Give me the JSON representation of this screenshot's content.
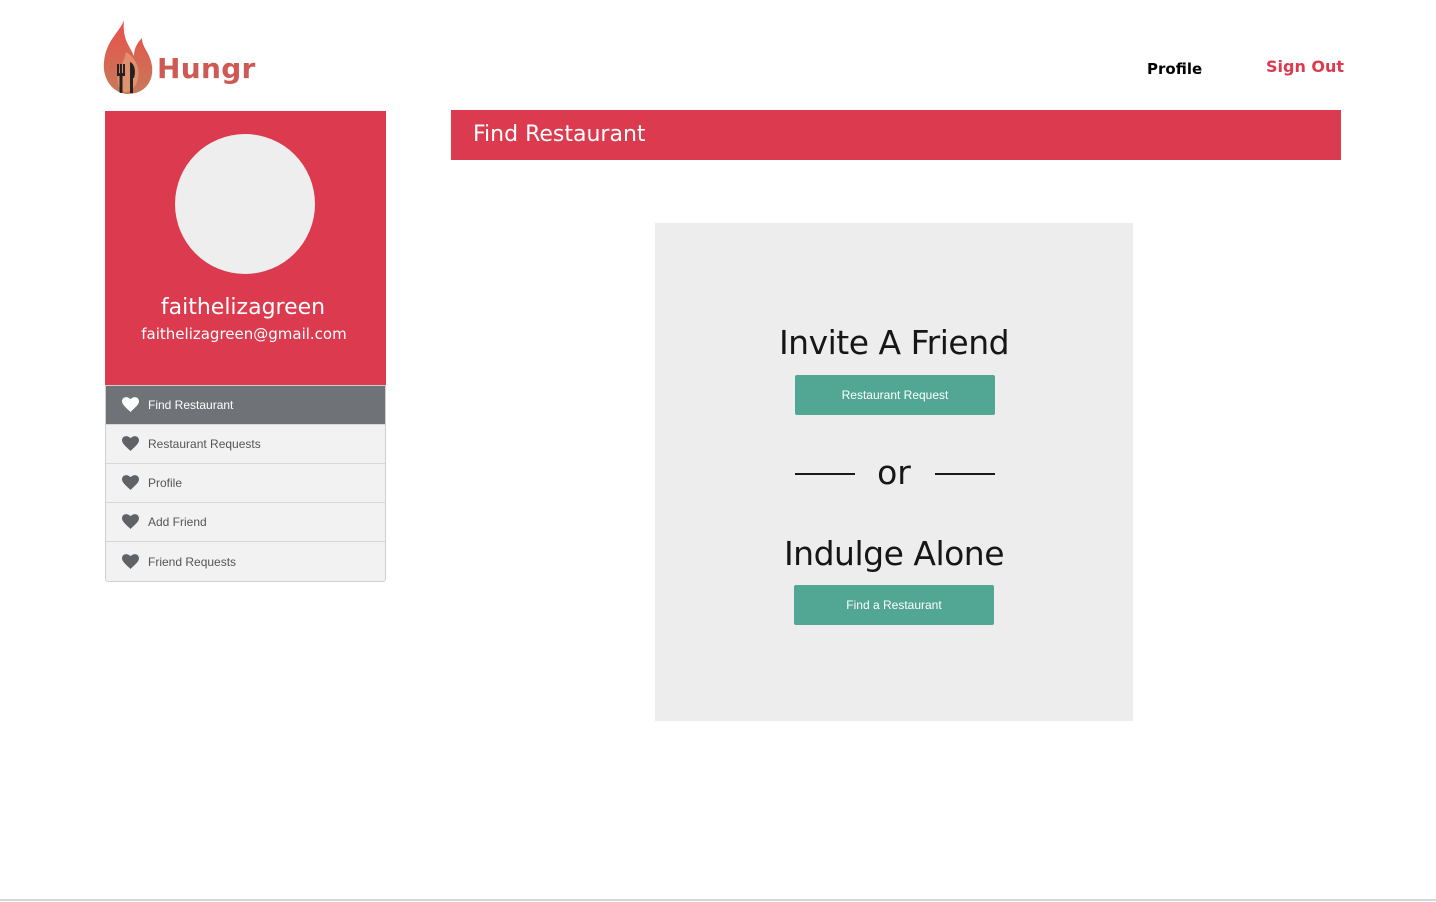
{
  "brand": {
    "name": "Hungr",
    "color": "#cf5a55"
  },
  "nav": {
    "profile_label": "Profile",
    "signout_label": "Sign Out"
  },
  "user": {
    "username": "faithelizagreen",
    "email": "faithelizagreen@gmail.com"
  },
  "sidebar": {
    "items": [
      {
        "label": "Find Restaurant",
        "icon": "heart-icon",
        "active": true
      },
      {
        "label": "Restaurant Requests",
        "icon": "heart-icon",
        "active": false
      },
      {
        "label": "Profile",
        "icon": "heart-icon",
        "active": false
      },
      {
        "label": "Add Friend",
        "icon": "heart-icon",
        "active": false
      },
      {
        "label": "Friend Requests",
        "icon": "heart-icon",
        "active": false
      }
    ]
  },
  "main": {
    "title": "Find Restaurant",
    "invite_heading": "Invite A Friend",
    "request_button": "Restaurant Request",
    "or_text": "or",
    "alone_heading": "Indulge Alone",
    "find_button": "Find a Restaurant"
  },
  "colors": {
    "accent": "#dc3a4e",
    "button": "#52a694",
    "panel": "#ededed",
    "active_menu": "#6f7276"
  }
}
